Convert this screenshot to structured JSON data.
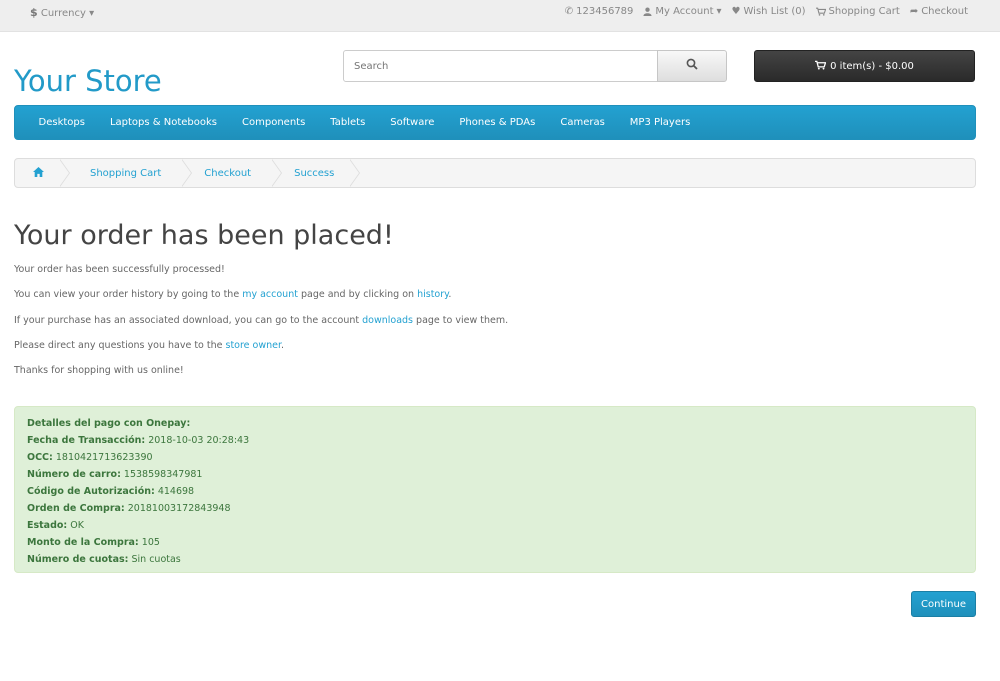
{
  "topbar": {
    "currency_symbol": "$",
    "currency_label": "Currency",
    "phone": "123456789",
    "my_account": "My Account",
    "wish_list": "Wish List (0)",
    "shopping_cart": "Shopping Cart",
    "checkout": "Checkout"
  },
  "header": {
    "logo": "Your Store",
    "search_placeholder": "Search",
    "cart_button": "0 item(s) - $0.00"
  },
  "menu": [
    "Desktops",
    "Laptops & Notebooks",
    "Components",
    "Tablets",
    "Software",
    "Phones & PDAs",
    "Cameras",
    "MP3 Players"
  ],
  "breadcrumb": [
    "Shopping Cart",
    "Checkout",
    "Success"
  ],
  "content": {
    "title": "Your order has been placed!",
    "line1": "Your order has been successfully processed!",
    "line2_a": "You can view your order history by going to the ",
    "line2_link1": "my account",
    "line2_b": " page and by clicking on ",
    "line2_link2": "history",
    "line2_c": ".",
    "line3_a": "If your purchase has an associated download, you can go to the account ",
    "line3_link": "downloads",
    "line3_b": " page to view them.",
    "line4_a": "Please direct any questions you have to the ",
    "line4_link": "store owner",
    "line4_b": ".",
    "line5": "Thanks for shopping with us online!"
  },
  "payment": {
    "heading": "Detalles del pago con Onepay:",
    "rows": [
      {
        "label": "Fecha de Transacción:",
        "value": "2018-10-03 20:28:43"
      },
      {
        "label": "OCC:",
        "value": "1810421713623390"
      },
      {
        "label": "Número de carro:",
        "value": "1538598347981"
      },
      {
        "label": "Código de Autorización:",
        "value": "414698"
      },
      {
        "label": "Orden de Compra:",
        "value": "20181003172843948"
      },
      {
        "label": "Estado:",
        "value": "OK"
      },
      {
        "label": "Monto de la Compra:",
        "value": "105"
      },
      {
        "label": "Número de cuotas:",
        "value": "Sin cuotas"
      }
    ]
  },
  "continue_label": "Continue",
  "colors": {
    "accent": "#23a1d1",
    "logo": "#229ac8",
    "alert_bg": "#dff0d8",
    "alert_text": "#3c763d"
  }
}
